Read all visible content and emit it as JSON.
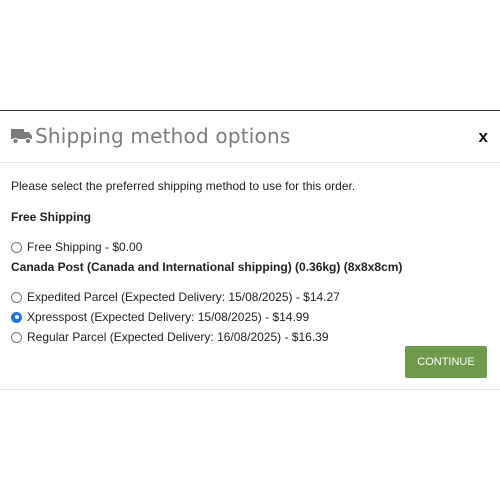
{
  "modal": {
    "title": "Shipping method options",
    "title_icon": "truck-icon",
    "close_label": "x",
    "instructions": "Please select the preferred shipping method to use for this order.",
    "groups": [
      {
        "title": "Free Shipping",
        "options": [
          {
            "label": "Free Shipping - $0.00",
            "selected": false
          }
        ]
      },
      {
        "title": "Canada Post (Canada and International shipping) (0.36kg) (8x8x8cm)",
        "options": [
          {
            "label": "Expedited Parcel (Expected Delivery: 15/08/2025) - $14.27",
            "selected": false
          },
          {
            "label": "Xpresspost (Expected Delivery: 15/08/2025) - $14.99",
            "selected": true
          },
          {
            "label": "Regular Parcel (Expected Delivery: 16/08/2025) - $16.39",
            "selected": false
          }
        ]
      }
    ],
    "continue_label": "CONTINUE"
  },
  "colors": {
    "title_text": "#7b7b7b",
    "continue_button": "#6f9a4b",
    "radio_selected": "#1a73e8"
  }
}
